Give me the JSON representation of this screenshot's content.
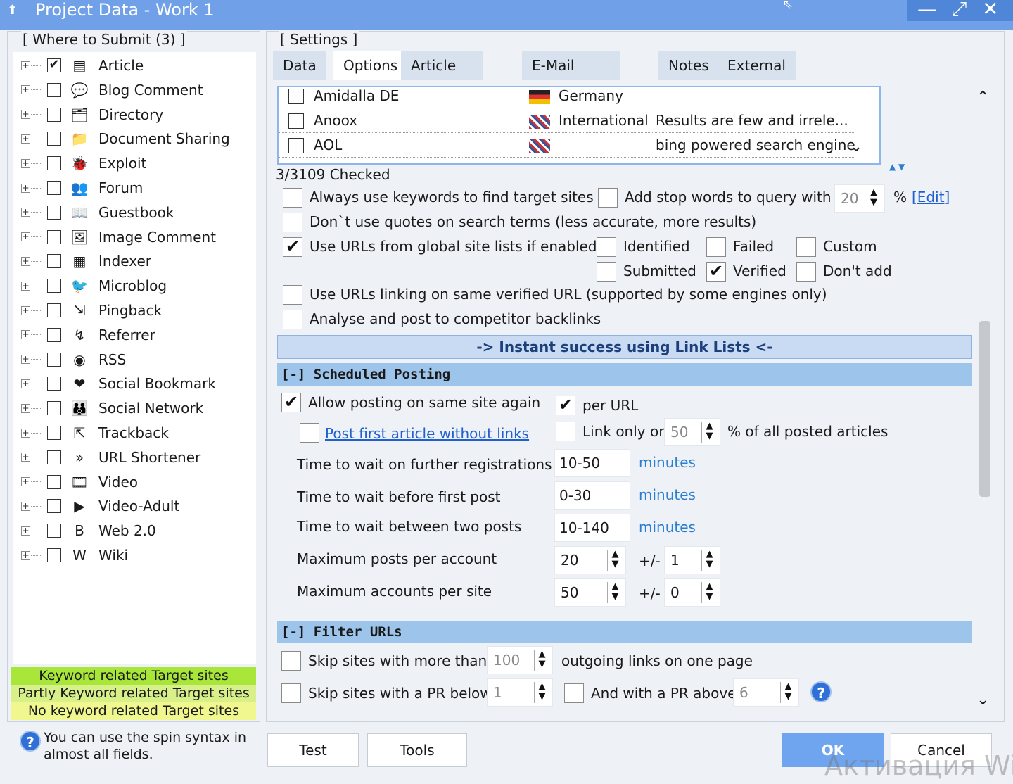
{
  "window": {
    "title": "Project Data - Work 1",
    "controls": {
      "minimize": "—",
      "maximize": "⤢",
      "close": "✕"
    }
  },
  "left_panel": {
    "caption": "[ Where to Submit  (3) ]",
    "items": [
      {
        "label": "Article",
        "checked": true,
        "icon": "article-icon",
        "glyph": "▤"
      },
      {
        "label": "Blog Comment",
        "checked": false,
        "icon": "speech-bubble-icon",
        "glyph": "💬"
      },
      {
        "label": "Directory",
        "checked": false,
        "icon": "directory-icon",
        "glyph": "🗂"
      },
      {
        "label": "Document Sharing",
        "checked": false,
        "icon": "folder-icon",
        "glyph": "📁"
      },
      {
        "label": "Exploit",
        "checked": false,
        "icon": "bug-icon",
        "glyph": "🐞"
      },
      {
        "label": "Forum",
        "checked": false,
        "icon": "users-icon",
        "glyph": "👥"
      },
      {
        "label": "Guestbook",
        "checked": false,
        "icon": "book-icon",
        "glyph": "📖"
      },
      {
        "label": "Image Comment",
        "checked": false,
        "icon": "image-icon",
        "glyph": "🖼"
      },
      {
        "label": "Indexer",
        "checked": false,
        "icon": "indexer-icon",
        "glyph": "▦"
      },
      {
        "label": "Microblog",
        "checked": false,
        "icon": "bird-icon",
        "glyph": "🐦"
      },
      {
        "label": "Pingback",
        "checked": false,
        "icon": "pingback-icon",
        "glyph": "⇲"
      },
      {
        "label": "Referrer",
        "checked": false,
        "icon": "referrer-icon",
        "glyph": "↯"
      },
      {
        "label": "RSS",
        "checked": false,
        "icon": "rss-icon",
        "glyph": "◉"
      },
      {
        "label": "Social Bookmark",
        "checked": false,
        "icon": "heart-icon",
        "glyph": "❤"
      },
      {
        "label": "Social Network",
        "checked": false,
        "icon": "people-icon",
        "glyph": "👪"
      },
      {
        "label": "Trackback",
        "checked": false,
        "icon": "trackback-icon",
        "glyph": "⇱"
      },
      {
        "label": "URL Shortener",
        "checked": false,
        "icon": "chevrons-icon",
        "glyph": "»"
      },
      {
        "label": "Video",
        "checked": false,
        "icon": "film-icon",
        "glyph": "🎞"
      },
      {
        "label": "Video-Adult",
        "checked": false,
        "icon": "play-icon",
        "glyph": "▶"
      },
      {
        "label": "Web 2.0",
        "checked": false,
        "icon": "blogger-icon",
        "glyph": "B"
      },
      {
        "label": "Wiki",
        "checked": false,
        "icon": "wiki-icon",
        "glyph": "W"
      }
    ],
    "legend": [
      {
        "text": "Keyword related Target sites",
        "color": "#a8e63a"
      },
      {
        "text": "Partly Keyword related Target sites",
        "color": "#d8f08a"
      },
      {
        "text": "No keyword related Target sites",
        "color": "#f1f78f"
      }
    ],
    "help_text": "You can use the spin syntax in almost all fields."
  },
  "right_panel": {
    "caption": "[ Settings ]",
    "tabs": [
      "Data",
      "Options",
      "Article Manager",
      "E-Mail verification",
      "Notes",
      "External APIs"
    ],
    "active_tab": "Options",
    "engines": [
      {
        "name": "Amidalla DE",
        "country": "Germany",
        "note": ""
      },
      {
        "name": "Anoox",
        "country": "International",
        "note": "Results are few and irrele..."
      },
      {
        "name": "AOL",
        "country": "",
        "note": "bing powered search engine"
      }
    ],
    "checked_count": "3/3109 Checked",
    "options": {
      "always_keywords": "Always use keywords to find target sites",
      "add_stop_words": "Add stop words to query with",
      "stop_words_value": "20",
      "percent": "%",
      "edit_link": "[Edit]",
      "no_quotes": "Don`t use quotes on search terms (less accurate, more results)",
      "use_global_lists": "Use URLs from global site lists if enabled",
      "identified": "Identified",
      "failed": "Failed",
      "custom": "Custom",
      "submitted": "Submitted",
      "verified": "Verified",
      "dont_add": "Don't add",
      "same_verified": "Use URLs linking on same verified URL (supported by some engines only)",
      "competitor": "Analyse and post to competitor backlinks"
    },
    "banner": "-> Instant success using Link Lists <-",
    "scheduled": {
      "header": "[-] Scheduled Posting",
      "allow_again": "Allow posting on same site again",
      "per_url": "per URL",
      "post_first": "Post first article without links",
      "link_only_on": "Link only on",
      "link_only_value": "50",
      "of_all_posted": "% of all posted articles",
      "wait_registrations": "Time to wait on further registrations",
      "wait_registrations_value": "10-50",
      "wait_first_post": "Time to wait before first post",
      "wait_first_post_value": "0-30",
      "wait_between": "Time to wait between two posts",
      "wait_between_value": "10-140",
      "minutes": "minutes",
      "max_posts": "Maximum posts per account",
      "max_posts_value": "20",
      "max_posts_plusminus": "1",
      "max_accounts": "Maximum accounts per site",
      "max_accounts_value": "50",
      "max_accounts_plusminus": "0",
      "plusminus_label": "+/-"
    },
    "filter": {
      "header": "[-] Filter URLs",
      "skip_more_than": "Skip sites with more than",
      "skip_more_value": "100",
      "outgoing": "outgoing links on one page",
      "skip_pr_below": "Skip sites with a PR below",
      "pr_below_value": "1",
      "and_pr_above": "And with a PR above",
      "pr_above_value": "6"
    }
  },
  "footer": {
    "test": "Test",
    "tools": "Tools",
    "ok": "OK",
    "cancel": "Cancel",
    "watermark": "Активация Win"
  }
}
